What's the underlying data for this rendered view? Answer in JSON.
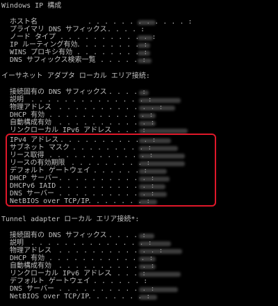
{
  "header": {
    "title": "Windows IP 構成"
  },
  "global": {
    "rows": [
      {
        "label": "ホスト名",
        "dots": ". . . . . . . . . . . . :",
        "value_redacted": true
      },
      {
        "label": "プライマリ DNS サフィックス",
        "dots": ". . . . :",
        "value_redacted": false
      },
      {
        "label": "ノード タイプ",
        "dots": ". . . . . . . . . . . :",
        "value_redacted": true
      },
      {
        "label": "IP ルーティング有効",
        "dots": ". . . . . . . . :",
        "value_redacted": true
      },
      {
        "label": "WINS プロキシ有効",
        "dots": ". . . . . . . . :",
        "value_redacted": true
      },
      {
        "label": "DNS サフィックス検索一覧",
        "dots": ". . . . . :",
        "value_redacted": true
      }
    ]
  },
  "ethernet": {
    "title": "イーサネット アダプタ ローカル エリア接続:",
    "rows": [
      {
        "label": "接続固有の DNS サフィックス",
        "dots": ". . . . :",
        "value_redacted": true
      },
      {
        "label": "説明",
        "dots": ". . . . . . . . . . . . . . :",
        "value_redacted": true
      },
      {
        "label": "物理アドレス",
        "dots": ". . . . . . . . . . . . :",
        "value_redacted": true
      },
      {
        "label": "DHCP 有効",
        "dots": ". . . . . . . . . . . . :",
        "value_redacted": true
      },
      {
        "label": "自動構成有効",
        "dots": ". . . . . . . . . . . :",
        "value_redacted": true
      },
      {
        "label": "リンクローカル IPv6 アドレス",
        "dots": ". . . . :",
        "value_redacted": true
      },
      {
        "label": "IPv4 アドレス",
        "dots": ". . . . . . . . . . . :",
        "value_redacted": true
      },
      {
        "label": "サブネット マスク",
        "dots": ". . . . . . . . . :",
        "value_redacted": true
      },
      {
        "label": "リース取得",
        "dots": ". . . . . . . . . . . . :",
        "value_redacted": true
      },
      {
        "label": "リースの有効期限",
        "dots": ". . . . . . . . . :",
        "value_redacted": true
      },
      {
        "label": "デフォルト ゲートウェイ",
        "dots": ". . . . . . :",
        "value_redacted": true
      },
      {
        "label": "DHCP サーバー",
        "dots": ". . . . . . . . . . . :",
        "value_redacted": true
      },
      {
        "label": "DHCPv6 IAID",
        "dots": ". . . . . . . . . . . :",
        "value_redacted": true
      },
      {
        "label": "DNS サーバー",
        "dots": ". . . . . . . . . . . :",
        "value_redacted": true
      },
      {
        "label": "NetBIOS over TCP/IP",
        "dots": ". . . . . . . :",
        "value_redacted": true
      }
    ]
  },
  "tunnel": {
    "title": "Tunnel adapter ローカル エリア接続*:",
    "rows": [
      {
        "label": "接続固有の DNS サフィックス",
        "dots": ". . . . :",
        "value_redacted": true
      },
      {
        "label": "説明",
        "dots": ". . . . . . . . . . . . . . :",
        "value_redacted": true
      },
      {
        "label": "物理アドレス",
        "dots": ". . . . . . . . . . . . :",
        "value_redacted": true
      },
      {
        "label": "DHCP 有効",
        "dots": ". . . . . . . . . . . . :",
        "value_redacted": true
      },
      {
        "label": "自動構成有効",
        "dots": ". . . . . . . . . . . :",
        "value_redacted": true
      },
      {
        "label": "リンクローカル IPv6 アドレス",
        "dots": ". . . . :",
        "value_redacted": true
      },
      {
        "label": "デフォルト ゲートウェイ",
        "dots": ". . . . . . :",
        "value_redacted": true
      },
      {
        "label": "DNS サーバー",
        "dots": ". . . . . . . . . . . :",
        "value_redacted": true
      },
      {
        "label": "NetBIOS over TCP/IP",
        "dots": ". . . . . . . :",
        "value_redacted": true
      }
    ]
  },
  "colors": {
    "background": "#000000",
    "text": "#c0c0c0",
    "highlight": "#e0182a"
  }
}
